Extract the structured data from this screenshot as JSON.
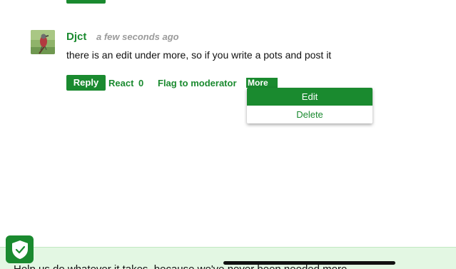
{
  "comment": {
    "author": "Djct",
    "timestamp": "a few seconds ago",
    "text": "there is an edit under more, so if you write a pots and post it"
  },
  "actions": {
    "reply_label": "Reply",
    "react_label": "React",
    "react_count": "0",
    "flag_label": "Flag to moderator",
    "more_label": "More"
  },
  "more_menu": {
    "items": [
      "Edit",
      "Delete"
    ]
  },
  "banner": {
    "text": "Help us do whatever it takes, because we've never been needed more."
  },
  "icons": {
    "avatar": "bird-avatar",
    "badge": "shield-check-icon"
  },
  "colors": {
    "accent": "#1a8a2f",
    "banner_bg": "#e3f7e3"
  }
}
